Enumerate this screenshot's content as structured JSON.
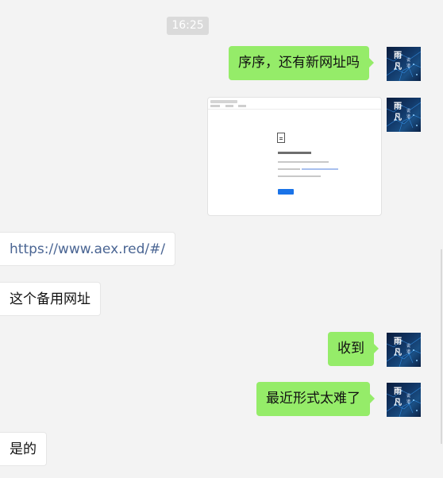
{
  "timestamp": "16:25",
  "messages": [
    {
      "side": "out",
      "type": "text",
      "text": "序序，还有新网址吗"
    },
    {
      "side": "out",
      "type": "image"
    },
    {
      "side": "in",
      "type": "link",
      "text": "https://www.aex.red/#/"
    },
    {
      "side": "in",
      "type": "text",
      "text": "这个备用网址"
    },
    {
      "side": "out",
      "type": "text",
      "text": "收到"
    },
    {
      "side": "out",
      "type": "text",
      "text": "最近形式太难了"
    },
    {
      "side": "in",
      "type": "text",
      "text": "是的"
    }
  ],
  "avatar": {
    "title": "雨凡",
    "subtitle": "说道"
  },
  "colors": {
    "outgoing_bubble": "#95ec69",
    "incoming_bubble": "#ffffff",
    "background": "#f3f3f3",
    "link": "#4a6593"
  }
}
